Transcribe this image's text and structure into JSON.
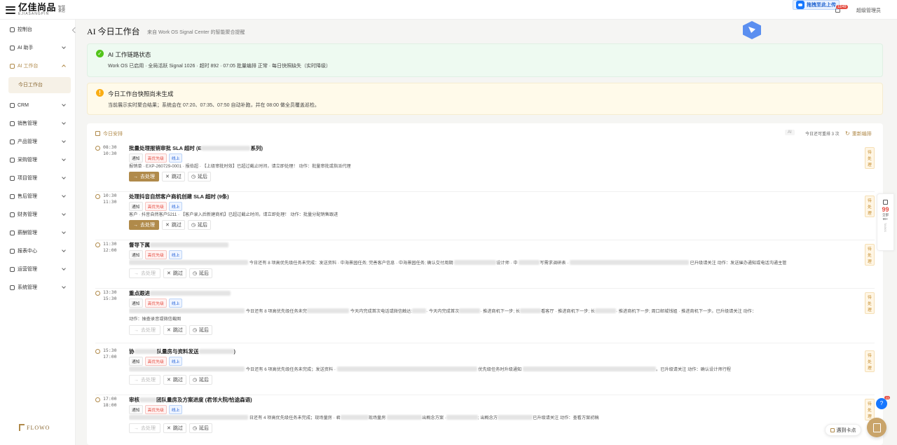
{
  "header": {
    "logo_text": "亿佳尚品",
    "logo_sub": "EJIASANGPIN",
    "logo_tag": "智慧家居",
    "upload_label": "拖拽至此上传",
    "notify_badge": "12/49",
    "user_name": "超级管理员"
  },
  "sidebar": {
    "items": [
      {
        "label": "控制台"
      },
      {
        "label": "AI 助手"
      },
      {
        "label": "AI 工作台"
      },
      {
        "label": "CRM"
      },
      {
        "label": "销售管理"
      },
      {
        "label": "产品管理"
      },
      {
        "label": "采购管理"
      },
      {
        "label": "项目管理"
      },
      {
        "label": "售后管理"
      },
      {
        "label": "财务管理"
      },
      {
        "label": "薪酬管理"
      },
      {
        "label": "报表中心"
      },
      {
        "label": "运营管理"
      },
      {
        "label": "系统管理"
      }
    ],
    "sub_active": "今日工作台",
    "footer_logo": "FLOWO"
  },
  "page": {
    "title": "AI 今日工作台",
    "subtitle": "来自 Work OS Signal Center 的智能聚合提醒"
  },
  "banner_ok": {
    "title": "AI 工作链路状态",
    "text": "Work OS 已启用 · 全局活跃 Signal 1026 · 超时 892 · 07:05 批量编排 正常 · 每日快照缺失（实时降级）"
  },
  "banner_warn": {
    "title": "今日工作台快照尚未生成",
    "text": "当前展示实时聚合结果；系统会在 07:20、07:35、07:50 自动补跑，并在 08:00 做全员覆盖巡检。"
  },
  "schedule": {
    "title": "今日安排",
    "ai_label": "AI",
    "redo_count": "今日还可重排 3 次",
    "redo_label": "重新编排",
    "tag_notice": "通知",
    "tag_high": "高优先级",
    "tag_online": "线上",
    "status": "待处理",
    "go_label": "去处理",
    "skip_label": "跳过",
    "delay_label": "延后",
    "tasks": [
      {
        "start": "08:30",
        "end": "10:30",
        "title_a": "批量处理报销审批 SLA 超时 (E",
        "title_b": "系列)",
        "desc": "报销单 · EXP-260729-0001 · 报伯超 · 【上级审批时效】已超过截止时间，请立即处理！    动作：批量审批或指派代理"
      },
      {
        "start": "10:30",
        "end": "11:30",
        "title_a": "处理抖音自然客户商机创建 SLA 超时 (9条)",
        "title_b": "",
        "desc": "客户 · 抖音自然客户5211 · 【客户录入后新建商机】已超过截止时间，请立即处理！    动作：批量分配销售跟进"
      },
      {
        "start": "11:30",
        "end": "12:00",
        "title_a": "督导下属",
        "title_b": "",
        "desc_a": "今日还有 8 项高优先级任务未完成：发送资料 · 中海景园任务; 完善客户信息 · 中海景园任务; 确认交付周期",
        "desc_b": "设计师 · 中",
        "desc_c": "写需求调研表 ·",
        "desc_d": "已升级请关注    动作：发送催办通知或电话沟通主管"
      },
      {
        "start": "13:30",
        "end": "15:30",
        "title_a": "重点跟进",
        "title_b": "",
        "desc_a": "今日还有 8 项高优先级任务未完",
        "desc_b": "今天内完成首次电话或微信触达:",
        "desc_c": "· 今天内完成首次",
        "desc_d": "· 推进商机下一步; 长",
        "desc_e": "看客厅 · 推进商机下一步; 长",
        "desc_f": "· 推进商机下一步; 周口邮城钱姐 · 推进商机下一步。已升级请关注    动作：",
        "desc2": "动作：抽查录音或微信截图"
      },
      {
        "start": "15:30",
        "end": "17:00",
        "title_a": "协",
        "title_b": "队量房与资料发送",
        "title_c": ")",
        "desc_a": "今日还有 6 项高优先级任务未完成；发送资料 ·",
        "desc_b": "优先级任务时升级通知",
        "desc_c": "。已升级请关注    动作：确认设计师行程"
      },
      {
        "start": "17:00",
        "end": "18:00",
        "title_a": "审核",
        "title_b": "团队量房及方案进度 (君邻大院/恰途森语)",
        "title_c": "",
        "desc_a": "日还有 4 项高优先级任务未完成；现场量房 · 君",
        "desc_b": "现场量房",
        "desc_c": "出概念方案 ·",
        "desc_d": "; 出概念方",
        "desc_e": "已升级请关注    动作：查看方案初稿"
      }
    ]
  },
  "float_panel": {
    "num": "99",
    "label_a": "全部",
    "label_b": "99+",
    "vertical": "TASKS"
  },
  "help_badge": "23",
  "issue_label": "遇到卡点"
}
